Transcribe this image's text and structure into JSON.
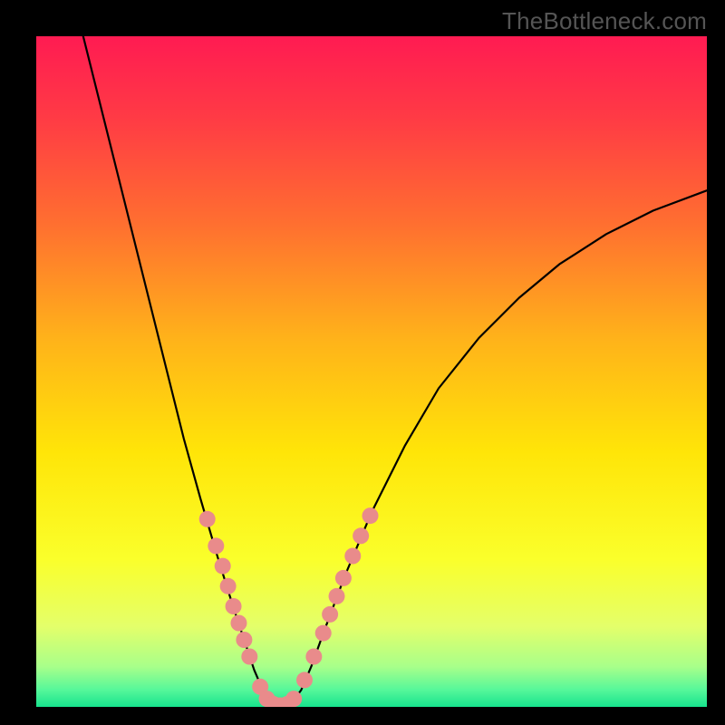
{
  "watermark": "TheBottleneck.com",
  "chart_data": {
    "type": "line",
    "title": "",
    "xlabel": "",
    "ylabel": "",
    "xlim": [
      0,
      100
    ],
    "ylim": [
      0,
      100
    ],
    "grid": false,
    "background": {
      "type": "vertical-gradient",
      "stops": [
        {
          "offset": 0.0,
          "color": "#ff1b52"
        },
        {
          "offset": 0.12,
          "color": "#ff3a45"
        },
        {
          "offset": 0.28,
          "color": "#ff6f30"
        },
        {
          "offset": 0.45,
          "color": "#ffb21a"
        },
        {
          "offset": 0.62,
          "color": "#ffe508"
        },
        {
          "offset": 0.78,
          "color": "#faff2b"
        },
        {
          "offset": 0.88,
          "color": "#e4ff6a"
        },
        {
          "offset": 0.94,
          "color": "#a8ff8a"
        },
        {
          "offset": 0.975,
          "color": "#55f79a"
        },
        {
          "offset": 1.0,
          "color": "#17e38d"
        }
      ]
    },
    "series": [
      {
        "name": "bottleneck-curve",
        "stroke": "#000000",
        "stroke_width": 2.2,
        "points": [
          {
            "x": 7.0,
            "y": 100.0
          },
          {
            "x": 9.5,
            "y": 90.0
          },
          {
            "x": 12.0,
            "y": 80.0
          },
          {
            "x": 14.5,
            "y": 70.0
          },
          {
            "x": 17.0,
            "y": 60.0
          },
          {
            "x": 19.5,
            "y": 50.0
          },
          {
            "x": 22.0,
            "y": 40.0
          },
          {
            "x": 24.5,
            "y": 31.0
          },
          {
            "x": 27.0,
            "y": 22.5
          },
          {
            "x": 29.5,
            "y": 14.5
          },
          {
            "x": 31.0,
            "y": 10.0
          },
          {
            "x": 32.5,
            "y": 5.5
          },
          {
            "x": 34.0,
            "y": 2.0
          },
          {
            "x": 35.0,
            "y": 0.5
          },
          {
            "x": 36.0,
            "y": 0.0
          },
          {
            "x": 37.0,
            "y": 0.0
          },
          {
            "x": 38.0,
            "y": 0.5
          },
          {
            "x": 39.5,
            "y": 2.5
          },
          {
            "x": 41.0,
            "y": 6.0
          },
          {
            "x": 43.0,
            "y": 11.5
          },
          {
            "x": 46.0,
            "y": 19.5
          },
          {
            "x": 50.0,
            "y": 29.0
          },
          {
            "x": 55.0,
            "y": 39.0
          },
          {
            "x": 60.0,
            "y": 47.5
          },
          {
            "x": 66.0,
            "y": 55.0
          },
          {
            "x": 72.0,
            "y": 61.0
          },
          {
            "x": 78.0,
            "y": 66.0
          },
          {
            "x": 85.0,
            "y": 70.5
          },
          {
            "x": 92.0,
            "y": 74.0
          },
          {
            "x": 100.0,
            "y": 77.0
          }
        ]
      }
    ],
    "markers": {
      "name": "highlight-dots",
      "fill": "#e98b8b",
      "radius": 9,
      "points": [
        {
          "x": 25.5,
          "y": 28.0
        },
        {
          "x": 26.8,
          "y": 24.0
        },
        {
          "x": 27.8,
          "y": 21.0
        },
        {
          "x": 28.6,
          "y": 18.0
        },
        {
          "x": 29.4,
          "y": 15.0
        },
        {
          "x": 30.2,
          "y": 12.5
        },
        {
          "x": 31.0,
          "y": 10.0
        },
        {
          "x": 31.8,
          "y": 7.5
        },
        {
          "x": 33.4,
          "y": 3.0
        },
        {
          "x": 34.4,
          "y": 1.2
        },
        {
          "x": 35.4,
          "y": 0.4
        },
        {
          "x": 36.4,
          "y": 0.2
        },
        {
          "x": 37.4,
          "y": 0.4
        },
        {
          "x": 38.4,
          "y": 1.2
        },
        {
          "x": 40.0,
          "y": 4.0
        },
        {
          "x": 41.4,
          "y": 7.5
        },
        {
          "x": 42.8,
          "y": 11.0
        },
        {
          "x": 43.8,
          "y": 13.8
        },
        {
          "x": 44.8,
          "y": 16.5
        },
        {
          "x": 45.8,
          "y": 19.2
        },
        {
          "x": 47.2,
          "y": 22.5
        },
        {
          "x": 48.4,
          "y": 25.5
        },
        {
          "x": 49.8,
          "y": 28.5
        }
      ]
    }
  }
}
